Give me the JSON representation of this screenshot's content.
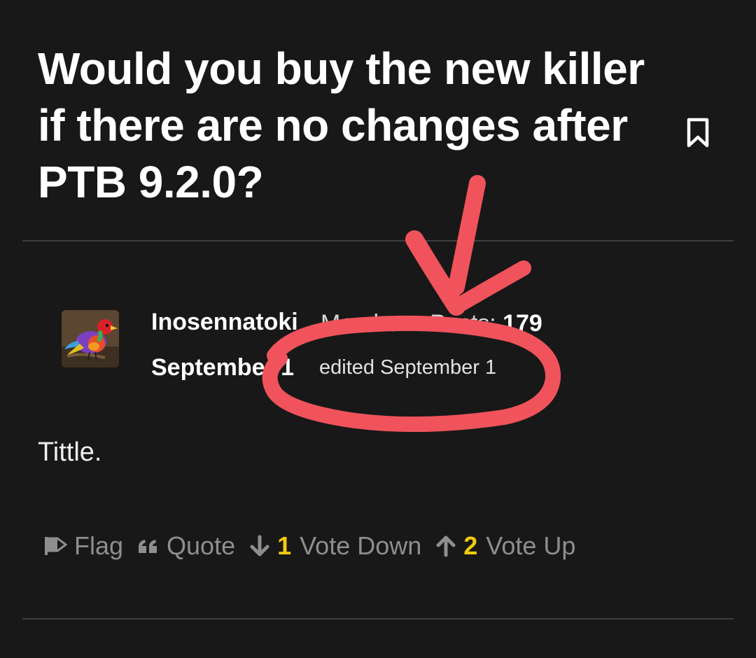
{
  "discussion": {
    "title": "Would you buy the new killer if there are no changes after PTB 9.2.0?"
  },
  "post": {
    "author": "Inosennatoki",
    "role_label": "Member",
    "posts_label": "Posts:",
    "posts_count": "179",
    "date": "September 1",
    "edited_label": "edited September 1",
    "body": "Tittle."
  },
  "actions": {
    "flag_label": "Flag",
    "quote_label": "Quote",
    "vote_down_count": "1",
    "vote_down_label": "Vote Down",
    "vote_up_count": "2",
    "vote_up_label": "Vote Up"
  },
  "icons": {
    "bookmark": "bookmark-icon",
    "flag": "flag-icon",
    "quote": "quote-icon",
    "vote_down": "arrow-down-icon",
    "vote_up": "arrow-up-icon"
  },
  "colors": {
    "background": "#181818",
    "text": "#ffffff",
    "muted": "#8e8e8e",
    "vote_count": "#f2cc0c",
    "annotation": "#f0535b"
  }
}
